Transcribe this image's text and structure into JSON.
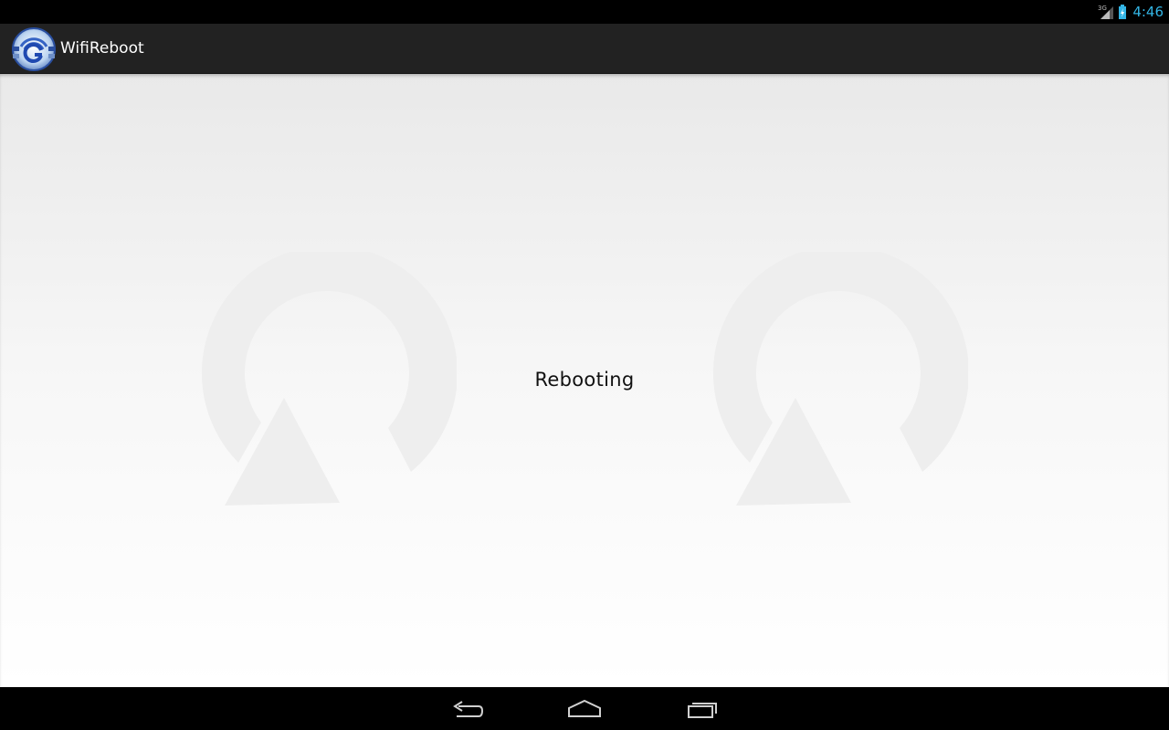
{
  "status_bar": {
    "network_type": "3G",
    "time": "4:46",
    "signal_icon": "cell-signal-icon",
    "battery_icon": "battery-charging-icon"
  },
  "action_bar": {
    "title": "WifiReboot",
    "logo_icon": "wifi-reboot-logo-icon"
  },
  "content": {
    "message": "Rebooting",
    "background_icons": [
      "reboot-arrow-icon",
      "reboot-arrow-icon"
    ]
  },
  "navigation_bar": {
    "buttons": [
      "back-icon",
      "home-icon",
      "recent-apps-icon"
    ]
  },
  "colors": {
    "status_accent": "#33b5e5",
    "action_bar": "#222222",
    "title_text": "#ffffff",
    "watermark": "#eeeeee"
  }
}
